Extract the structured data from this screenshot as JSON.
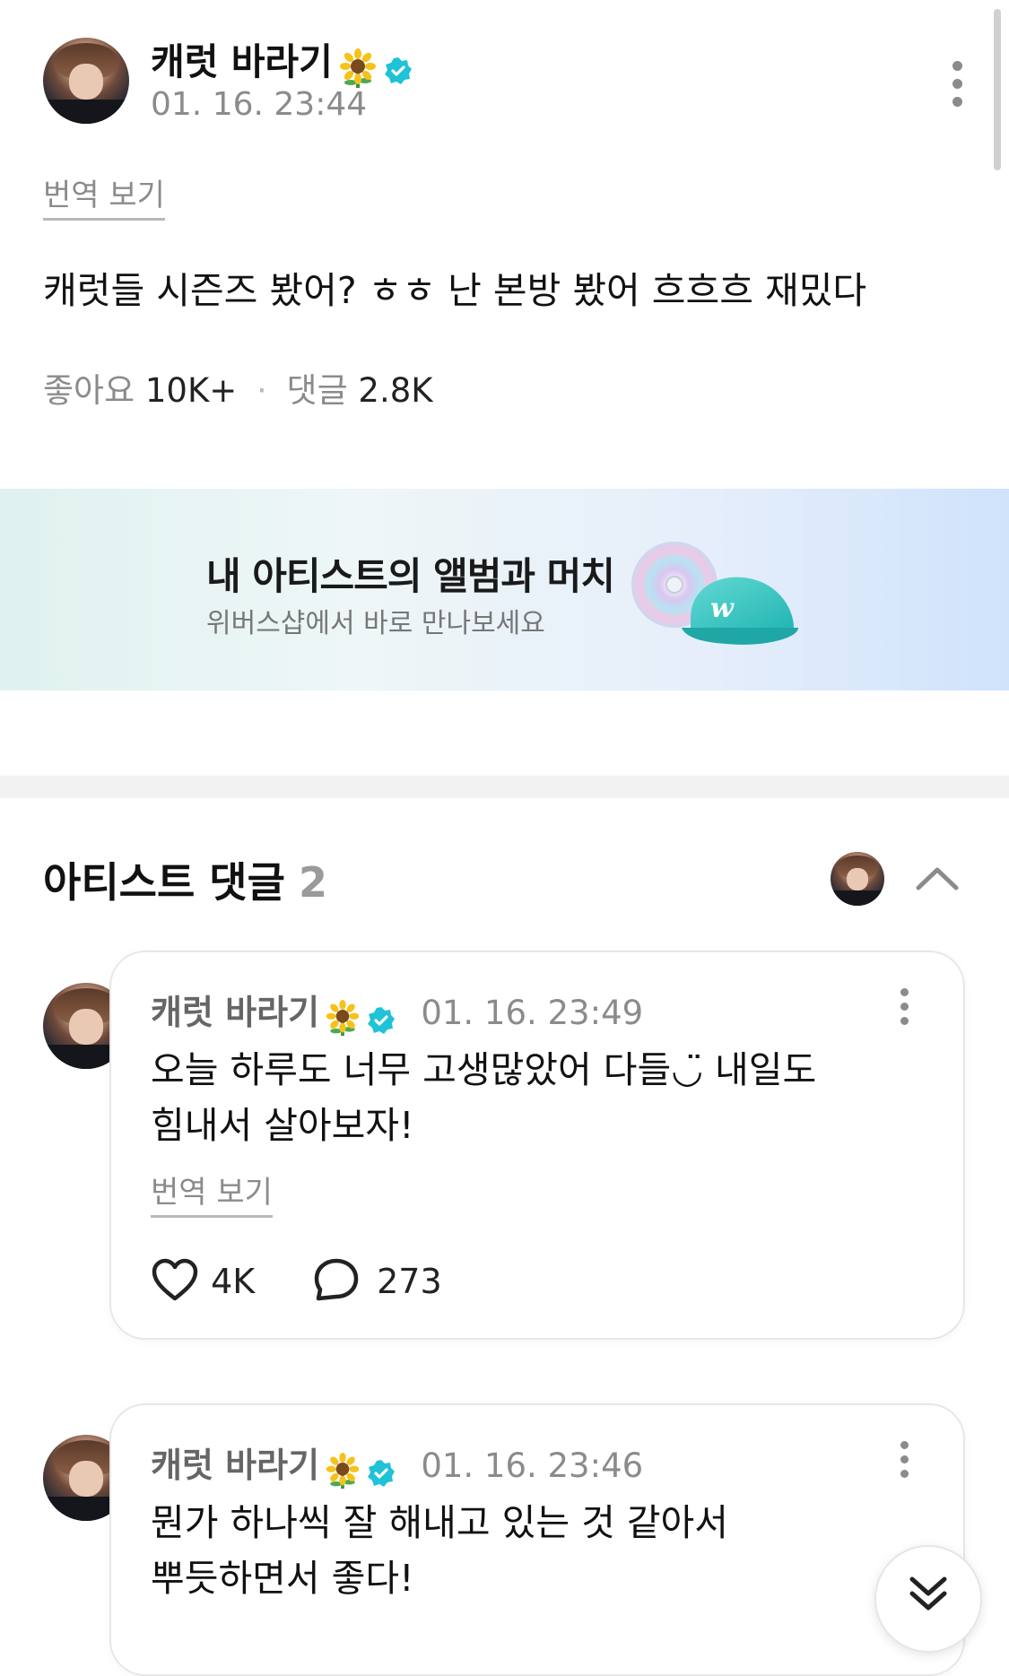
{
  "post": {
    "author": "캐럿 바라기",
    "timestamp": "01. 16. 23:44",
    "translate_label": "번역 보기",
    "body": "캐럿들 시즌즈 봤어? ㅎㅎ 난 본방 봤어 흐흐흐 재밌다",
    "likes_label": "좋아요",
    "likes_value": "10K+",
    "stats_separator": "·",
    "comments_label": "댓글",
    "comments_value": "2.8K"
  },
  "banner": {
    "title": "내 아티스트의 앨범과 머치",
    "subtitle": "위버스샵에서 바로 만나보세요",
    "cap_logo": "w"
  },
  "artist_comments": {
    "title": "아티스트 댓글",
    "count": "2",
    "items": [
      {
        "author": "캐럿 바라기",
        "timestamp": "01. 16. 23:49",
        "text_line1": "오늘 하루도 너무 고생많았어 다들◡̈ 내일도",
        "text_line2": "힘내서 살아보자!",
        "translate_label": "번역 보기",
        "likes": "4K",
        "replies": "273"
      },
      {
        "author": "캐럿 바라기",
        "timestamp": "01. 16. 23:46",
        "text_line1": "뭔가 하나씩 잘 해내고 있는 것 같아서",
        "text_line2": "뿌듯하면서 좋다!"
      }
    ]
  },
  "colors": {
    "verified": "#1fc2d6",
    "muted_text": "#8b8b8b",
    "banner_cap": "#2fc4c0"
  },
  "icons": [
    "verified-badge-icon",
    "sunflower-icon",
    "more-vertical-icon",
    "heart-icon",
    "comment-bubble-icon",
    "chevron-up-icon",
    "double-chevron-down-icon"
  ]
}
